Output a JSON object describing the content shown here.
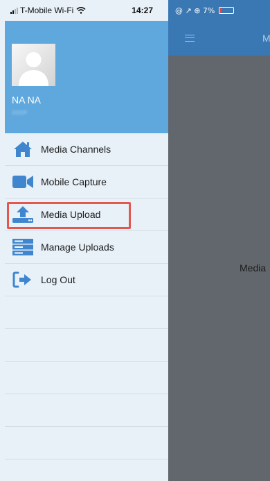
{
  "status_bar": {
    "carrier": "T-Mobile Wi-Fi",
    "time": "14:27",
    "right_indicators": "@ ↗ ⊕ 7%"
  },
  "main_app": {
    "header_title": "M",
    "content_text": "Media"
  },
  "drawer": {
    "profile": {
      "name": "NA NA",
      "sub": "0000F"
    },
    "menu": [
      {
        "label": "Media Channels",
        "icon": "home-icon"
      },
      {
        "label": "Mobile Capture",
        "icon": "video-camera-icon"
      },
      {
        "label": "Media Upload",
        "icon": "upload-icon"
      },
      {
        "label": "Manage Uploads",
        "icon": "server-stack-icon"
      },
      {
        "label": "Log Out",
        "icon": "logout-icon"
      }
    ],
    "highlighted_item": "Media Upload"
  },
  "colors": {
    "drawer_bg": "#e8f1f8",
    "profile_bg": "#5fa8de",
    "icon_blue": "#3f86cf",
    "header_blue": "#3a78b4",
    "overlay_gray": "#62676d",
    "highlight_red": "#e3584e"
  }
}
